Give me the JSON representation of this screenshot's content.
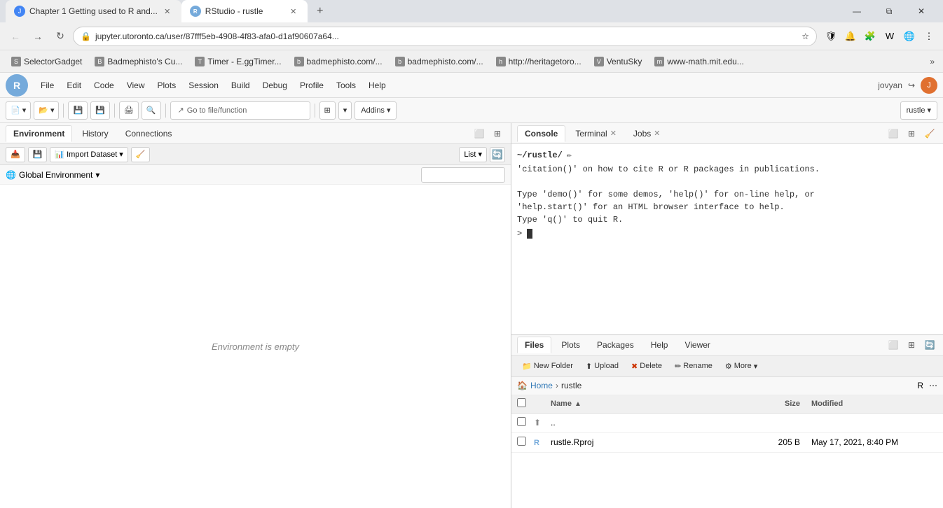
{
  "browser": {
    "tabs": [
      {
        "id": "tab1",
        "label": "Chapter 1 Getting used to R and...",
        "favicon_type": "blue",
        "favicon_text": "J",
        "active": false
      },
      {
        "id": "tab2",
        "label": "RStudio - rustle",
        "favicon_type": "rstudio",
        "favicon_text": "R",
        "active": true
      }
    ],
    "address_url": "jupyter.utoronto.ca/user/87fff5eb-4908-4f83-afa0-d1af90607a64...",
    "bookmarks": [
      {
        "label": "SelectorGadget",
        "icon": "S"
      },
      {
        "label": "Badmephisto's Cu...",
        "icon": "B"
      },
      {
        "label": "Timer - E.ggTimer...",
        "icon": "T"
      },
      {
        "label": "badmephisto.com/...",
        "icon": "b"
      },
      {
        "label": "badmephisto.com/...",
        "icon": "b"
      },
      {
        "label": "http://heritagetoro...",
        "icon": "h"
      },
      {
        "label": "VentuSky",
        "icon": "V"
      },
      {
        "label": "www-math.mit.edu...",
        "icon": "m"
      }
    ]
  },
  "rstudio": {
    "menu_items": [
      "File",
      "Edit",
      "Code",
      "View",
      "Plots",
      "Session",
      "Build",
      "Debug",
      "Profile",
      "Tools",
      "Help"
    ],
    "user": "jovyan",
    "project": "rustle",
    "toolbar": {
      "go_to_file": "Go to file/function",
      "addins": "Addins",
      "project": "rustle"
    },
    "left_panel": {
      "tabs": [
        "Environment",
        "History",
        "Connections"
      ],
      "active_tab": "Environment",
      "env_toolbar": {
        "import_dataset": "Import Dataset",
        "list_label": "List",
        "broom_icon": "🧹"
      },
      "global_env": "Global Environment",
      "search_placeholder": "",
      "empty_message": "Environment is empty"
    },
    "console_panel": {
      "tabs": [
        {
          "label": "Console",
          "active": true,
          "closeable": false
        },
        {
          "label": "Terminal",
          "active": false,
          "closeable": true
        },
        {
          "label": "Jobs",
          "active": false,
          "closeable": true
        }
      ],
      "cwd": "~/rustle/",
      "content": "'citation()' on how to cite R or R packages in publications.\n\nType 'demo()' for some demos, 'help()' for on-line help, or\n'help.start()' for an HTML browser interface to help.\nType 'q()' to quit R.\n",
      "prompt": ">"
    },
    "files_panel": {
      "tabs": [
        "Files",
        "Plots",
        "Packages",
        "Help",
        "Viewer"
      ],
      "active_tab": "Files",
      "toolbar_buttons": [
        {
          "label": "New Folder",
          "icon": "📁"
        },
        {
          "label": "Upload",
          "icon": "⬆"
        },
        {
          "label": "Delete",
          "icon": "✖"
        },
        {
          "label": "Rename",
          "icon": "✏"
        },
        {
          "label": "More",
          "icon": "⚙"
        }
      ],
      "breadcrumb": {
        "home": "Home",
        "current": "rustle"
      },
      "columns": {
        "name": "Name",
        "size": "Size",
        "modified": "Modified"
      },
      "files": [
        {
          "name": "..",
          "icon": "⬆",
          "icon_type": "up",
          "size": "",
          "modified": "",
          "is_dir": true
        },
        {
          "name": "rustle.Rproj",
          "icon": "R",
          "icon_type": "rproj",
          "size": "205 B",
          "modified": "May 17, 2021, 8:40 PM",
          "is_dir": false
        }
      ]
    }
  }
}
